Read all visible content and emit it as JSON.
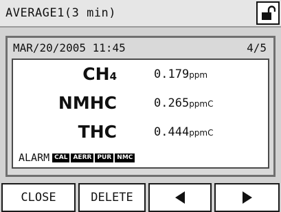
{
  "header": {
    "title": "AVERAGE1(3 min)",
    "lock_icon": "unlock-icon"
  },
  "record": {
    "datetime": "MAR/20/2005 11:45",
    "page": "4/5"
  },
  "measurements": [
    {
      "name_main": "CH",
      "name_sub": "4",
      "value": "0.179",
      "unit": "ppm"
    },
    {
      "name_main": "NMHC",
      "name_sub": "",
      "value": "0.265",
      "unit": "ppmC"
    },
    {
      "name_main": "THC",
      "name_sub": "",
      "value": "0.444",
      "unit": "ppmC"
    }
  ],
  "alarm": {
    "label": "ALARM",
    "badges": [
      "CAL",
      "AERR",
      "PUR",
      "NMC"
    ]
  },
  "buttons": {
    "close": "CLOSE",
    "delete": "DELETE",
    "prev_icon": "left-arrow-icon",
    "next_icon": "right-arrow-icon"
  }
}
